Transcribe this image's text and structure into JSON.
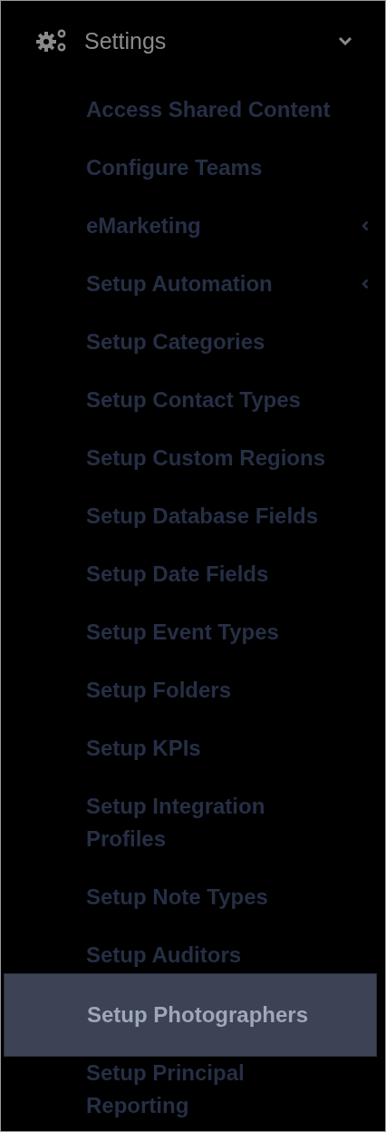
{
  "menu": {
    "title": "Settings",
    "expanded": true,
    "items": [
      {
        "label": "Access Shared Content",
        "has_submenu": false,
        "selected": false
      },
      {
        "label": "Configure Teams",
        "has_submenu": false,
        "selected": false
      },
      {
        "label": "eMarketing",
        "has_submenu": true,
        "selected": false
      },
      {
        "label": "Setup Automation",
        "has_submenu": true,
        "selected": false
      },
      {
        "label": "Setup Categories",
        "has_submenu": false,
        "selected": false
      },
      {
        "label": "Setup Contact Types",
        "has_submenu": false,
        "selected": false
      },
      {
        "label": "Setup Custom Regions",
        "has_submenu": false,
        "selected": false
      },
      {
        "label": "Setup Database Fields",
        "has_submenu": false,
        "selected": false
      },
      {
        "label": "Setup Date Fields",
        "has_submenu": false,
        "selected": false
      },
      {
        "label": "Setup Event Types",
        "has_submenu": false,
        "selected": false
      },
      {
        "label": "Setup Folders",
        "has_submenu": false,
        "selected": false
      },
      {
        "label": "Setup KPIs",
        "has_submenu": false,
        "selected": false
      },
      {
        "label": "Setup Integration Profiles",
        "has_submenu": false,
        "selected": false
      },
      {
        "label": "Setup Note Types",
        "has_submenu": false,
        "selected": false
      },
      {
        "label": "Setup Auditors",
        "has_submenu": false,
        "selected": false
      },
      {
        "label": "Setup Photographers",
        "has_submenu": false,
        "selected": true
      },
      {
        "label": "Setup Principal Reporting",
        "has_submenu": false,
        "selected": false
      }
    ]
  }
}
